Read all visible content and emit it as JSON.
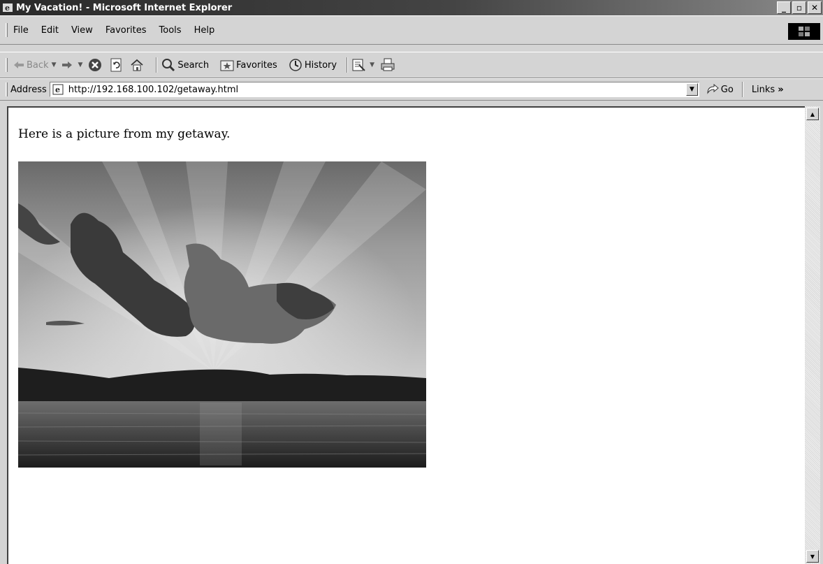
{
  "window": {
    "title": "My Vacation! - Microsoft Internet Explorer"
  },
  "menu": {
    "items": [
      "File",
      "Edit",
      "View",
      "Favorites",
      "Tools",
      "Help"
    ]
  },
  "toolbar": {
    "back_label": "Back",
    "search_label": "Search",
    "favorites_label": "Favorites",
    "history_label": "History"
  },
  "addressbar": {
    "label": "Address",
    "url": "http://192.168.100.102/getaway.html",
    "go_label": "Go",
    "links_label": "Links"
  },
  "page": {
    "text": "Here is a picture from my getaway."
  },
  "icons": {
    "app": "ie-icon",
    "back": "back-arrow-icon",
    "forward": "forward-arrow-icon",
    "stop": "stop-icon",
    "refresh": "refresh-icon",
    "home": "home-icon",
    "search": "search-icon",
    "favorites": "favorites-icon",
    "history": "history-icon",
    "mail": "mail-icon",
    "print": "print-icon",
    "go": "go-arrow-icon"
  }
}
